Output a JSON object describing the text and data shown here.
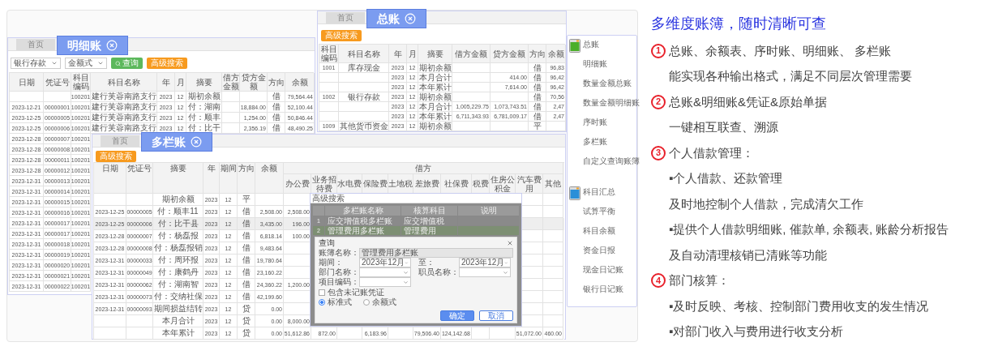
{
  "general_ledger": {
    "tabs": [
      {
        "label": "首页",
        "selected": false
      },
      {
        "label": "总账",
        "selected": true
      }
    ],
    "buttons": [
      "高级搜索"
    ],
    "columns": [
      "科目编码",
      "科目名称",
      "年",
      "月",
      "摘要",
      "借方金额",
      "贷方金额",
      "方向",
      "余额"
    ],
    "rows": [
      [
        "1001",
        "库存现金",
        "2023",
        "12",
        "期初余额",
        "",
        "",
        "借",
        "96,83"
      ],
      [
        "",
        "",
        "2023",
        "12",
        "本月合计",
        "",
        "414.00",
        "借",
        "96,42"
      ],
      [
        "",
        "",
        "2023",
        "12",
        "本年累计",
        "",
        "7,614.00",
        "借",
        "96,42"
      ],
      [
        "1002",
        "银行存款",
        "2023",
        "12",
        "期初余额",
        "",
        "",
        "借",
        "70,56"
      ],
      [
        "",
        "",
        "2023",
        "12",
        "本月合计",
        "1,005,229.75",
        "1,073,743.51",
        "借",
        "2,47"
      ],
      [
        "",
        "",
        "2023",
        "12",
        "本年累计",
        "6,711,343.93",
        "6,781,009.17",
        "借",
        "2,47"
      ],
      [
        "1009",
        "其他货币资金",
        "2023",
        "12",
        "期初余额",
        "",
        "",
        "平",
        ""
      ]
    ]
  },
  "detail_ledger": {
    "tabs": [
      {
        "label": "首页",
        "selected": false
      },
      {
        "label": "明细账",
        "selected": true
      }
    ],
    "filters": [
      "银行存款",
      "金额式"
    ],
    "buttons": [
      {
        "kind": "query",
        "label": "查询"
      },
      {
        "kind": "advanced",
        "label": "高级搜索"
      }
    ],
    "columns": [
      "日期",
      "凭证号",
      "科目编码",
      "科目名称",
      "年",
      "月",
      "摘要",
      "借方金额",
      "贷方金额",
      "方向",
      "余额"
    ],
    "rows": [
      [
        "",
        "",
        "100201",
        "建行芙蓉南路支行",
        "2023",
        "12",
        "期初余额",
        "",
        "",
        "借",
        "79,564.44"
      ],
      [
        "2023-12-21",
        "00000001",
        "100201",
        "建行芙蓉南路支行",
        "2023",
        "12",
        "付：湖南",
        "",
        "18,884.00",
        "借",
        "52,100.44"
      ],
      [
        "2023-12-25",
        "00000005",
        "100201",
        "建行芙蓉南路支行",
        "2023",
        "12",
        "付：顺丰",
        "",
        "1,254.00",
        "借",
        "50,846.44"
      ],
      [
        "2023-12-25",
        "00000006",
        "100201",
        "建行芙蓉南路支行",
        "2023",
        "12",
        "付：比干",
        "",
        "2,356.19",
        "借",
        "48,490.25"
      ],
      [
        "2023-12-28",
        "00000007",
        "100201"
      ],
      [
        "2023-12-28",
        "00000008",
        "100201"
      ],
      [
        "2023-12-28",
        "00000011",
        "100201"
      ],
      [
        "2023-12-28",
        "00000012",
        "100201"
      ],
      [
        "2023-12-31",
        "00000013",
        "100201"
      ],
      [
        "2023-12-31",
        "00000014",
        "100201"
      ],
      [
        "2023-12-31",
        "00000015",
        "100201"
      ],
      [
        "2023-12-31",
        "00000016",
        "100201"
      ],
      [
        "2023-12-31",
        "00000017",
        "100201"
      ],
      [
        "2023-12-31",
        "00000017",
        "100201"
      ],
      [
        "2023-12-31",
        "00000018",
        "100201"
      ],
      [
        "2023-12-31",
        "00000019",
        "100201"
      ],
      [
        "2023-12-31",
        "00000020",
        "100201"
      ],
      [
        "2023-12-31",
        "00000021",
        "100201"
      ],
      [
        "2023-12-31",
        "00000022",
        "100201"
      ]
    ]
  },
  "multi_column_ledger": {
    "tabs": [
      {
        "label": "首页",
        "selected": false
      },
      {
        "label": "多栏账",
        "selected": true
      }
    ],
    "buttons": [
      "高级搜索"
    ],
    "columns": [
      "日期",
      "凭证号",
      "摘要",
      "年",
      "期间",
      "方向",
      "余额"
    ],
    "group_header": "借方",
    "group_columns": [
      "办公费",
      "业务招待费",
      "水电费",
      "保险费",
      "土地税",
      "差旅费",
      "社保费",
      "税费",
      "住房公积金",
      "汽车费用",
      "其他"
    ],
    "rows": [
      {
        "selected": false,
        "cells": [
          "",
          "",
          "期初余额",
          "2023",
          "12",
          "平",
          "",
          ""
        ]
      },
      {
        "selected": false,
        "cells": [
          "2023-12-25",
          "00000005",
          "付：顺丰11",
          "2023",
          "12",
          "借",
          "2,508.00",
          "2,508.00"
        ]
      },
      {
        "selected": true,
        "cells": [
          "2023-12-25",
          "00000006",
          "付：比干县",
          "2023",
          "12",
          "借",
          "3,435.00",
          "196.00"
        ]
      },
      {
        "selected": false,
        "cells": [
          "2023-12-28",
          "00000007",
          "付：杨磊报",
          "2023",
          "12",
          "借",
          "6,818.14",
          "100.00"
        ]
      },
      {
        "selected": false,
        "cells": [
          "2023-12-28",
          "00000008",
          "付：杨磊报销",
          "2023",
          "12",
          "借",
          "9,483.64",
          ""
        ]
      },
      {
        "selected": false,
        "cells": [
          "2023-12-31",
          "00000033",
          "付：周环报",
          "2023",
          "12",
          "借",
          "19,780.64",
          ""
        ]
      },
      {
        "selected": false,
        "cells": [
          "2023-12-31",
          "00000049",
          "付：康鹤丹",
          "2023",
          "12",
          "借",
          "23,160.22",
          ""
        ]
      },
      {
        "selected": false,
        "cells": [
          "2023-12-31",
          "00000062",
          "付：湖南智",
          "2023",
          "12",
          "借",
          "24,360.22",
          "1,200.00"
        ]
      },
      {
        "selected": false,
        "cells": [
          "2023-12-31",
          "00000073",
          "付：交纳社保",
          "2023",
          "12",
          "借",
          "42,199.60",
          ""
        ]
      },
      {
        "selected": false,
        "cells": [
          "2023-12-31",
          "00000093",
          "期间损益结转",
          "2023",
          "12",
          "贷",
          "0.00",
          ""
        ]
      },
      {
        "selected": false,
        "cells": [
          "",
          "",
          "本月合计",
          "2023",
          "12",
          "贷",
          "0.00",
          "8,000.00"
        ]
      },
      {
        "selected": false,
        "cells": [
          "",
          "",
          "本年累计",
          "2023",
          "12",
          "贷",
          "0.00",
          "51,612.86",
          "872.00",
          "",
          "6,183.96",
          "",
          "79,506.40",
          "124,142.68",
          "",
          "",
          "51,072.00",
          "460.00"
        ]
      }
    ]
  },
  "advanced_search": {
    "title": "高级搜索",
    "columns": [
      "多栏账名称",
      "核算科目",
      "说明"
    ],
    "rows": [
      {
        "index": "1",
        "cells": [
          "应交增值税多栏账",
          "应交增值税"
        ],
        "selected": false
      },
      {
        "index": "2",
        "cells": [
          "管理费用多栏账",
          "管理费用"
        ],
        "selected": true
      }
    ],
    "query": {
      "title": "查询",
      "fields": [
        {
          "kind": "text",
          "label": "账簿名称：",
          "value": "管理费用多栏账",
          "disabled": true
        },
        {
          "kind": "select",
          "label": "期间：",
          "value": "2023年12月",
          "disabled": false
        },
        {
          "kind": "select",
          "label": "至：",
          "value": "2023年12月",
          "disabled": false
        },
        {
          "kind": "select",
          "label": "部门名称：",
          "disabled": false
        },
        {
          "kind": "select",
          "label": "职员名称：",
          "disabled": false
        },
        {
          "kind": "select",
          "label": "项目编码：",
          "disabled": false
        }
      ],
      "checkbox": {
        "label": "包含未记账凭证",
        "checked": false
      },
      "radios": [
        {
          "label": "标准式",
          "selected": true
        },
        {
          "label": "余额式",
          "selected": false
        }
      ],
      "buttons": [
        {
          "label": "确定",
          "primary": true
        },
        {
          "label": "取消",
          "primary": false
        }
      ]
    }
  },
  "ledger_menu": {
    "groups": [
      {
        "items": [
          "总账",
          "明细账",
          "数量金额总账",
          "数量金额明细账",
          "序时账",
          "多栏账",
          "自定义查询账簿"
        ]
      },
      {
        "items": [
          "科目汇总",
          "试算平衡",
          "科目余额",
          "资金日报",
          "现金日记账",
          "银行日记账"
        ]
      }
    ]
  },
  "features": {
    "title": "多维度账簿，随时清晰可查",
    "sections": [
      {
        "number": "1",
        "heading": "总账、余额表、序时账、明细账、 多栏账",
        "lines": [
          "能实现各种输出格式，满足不同层次管理需要"
        ]
      },
      {
        "number": "2",
        "heading": "总账&明细账&凭证&原始单据",
        "lines": [
          "一键相互联查、溯源"
        ]
      },
      {
        "number": "3",
        "heading": "个人借款管理：",
        "lines": [
          "▪个人借款、还款管理",
          "及时地控制个人借款，完成清欠工作",
          "▪提供个人借款明细账, 催款单, 余额表, 账龄分析报告",
          "及自动清理核销已清账等功能"
        ]
      },
      {
        "number": "4",
        "heading": "部门核算：",
        "lines": [
          "▪及时反映、考核、控制部门费用收支的发生情况",
          "▪对部门收入与费用进行收支分析"
        ]
      }
    ]
  }
}
